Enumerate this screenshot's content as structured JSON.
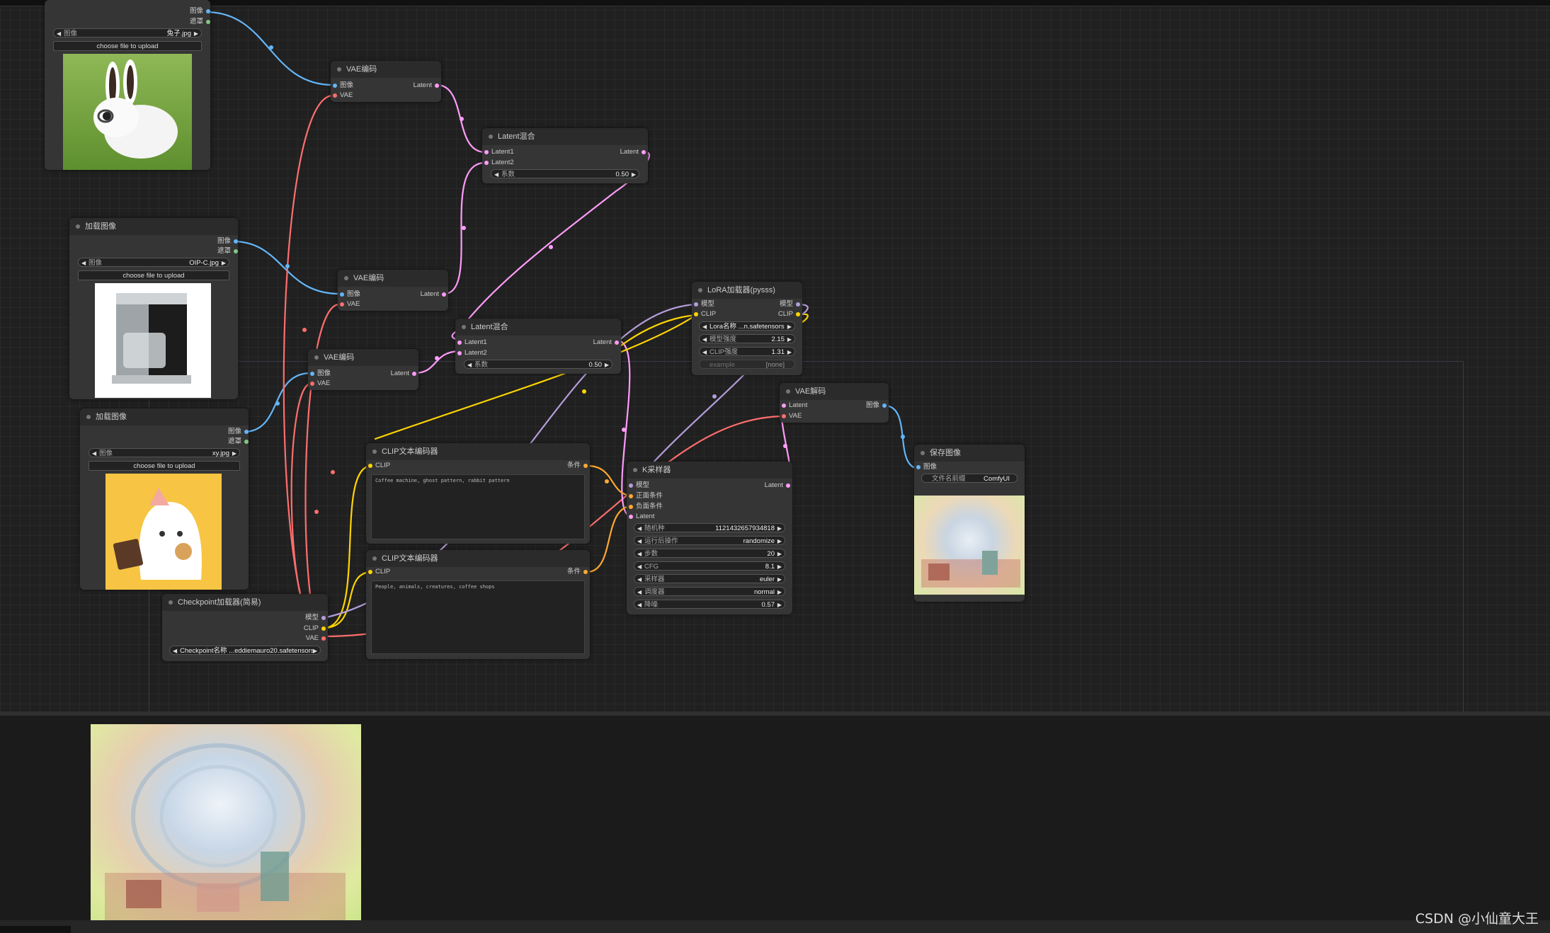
{
  "colors": {
    "image": "#64b5f6",
    "mask": "#81c784",
    "latent": "#ff9cf9",
    "vae": "#ff6e6e",
    "clip": "#ffd500",
    "model": "#b39ddb",
    "conditioning": "#ffa931"
  },
  "nodes": {
    "load_image_1": {
      "outputs": [
        "图像",
        "遮罩"
      ],
      "image_label": "图像",
      "image_value": "兔子.jpg",
      "upload": "choose file to upload",
      "icon": "rabbit-photo"
    },
    "load_image_2": {
      "title": "加载图像",
      "outputs": [
        "图像",
        "遮罩"
      ],
      "image_label": "图像",
      "image_value": "OIP-C.jpg",
      "upload": "choose file to upload",
      "icon": "coffee-machine-photo"
    },
    "load_image_3": {
      "title": "加载图像",
      "outputs": [
        "图像",
        "遮罩"
      ],
      "image_label": "图像",
      "image_value": "xy.jpg",
      "upload": "choose file to upload",
      "icon": "ghost-illustration"
    },
    "vae_encode_1": {
      "title": "VAE编码",
      "inputs": [
        "图像",
        "VAE"
      ],
      "output": "Latent"
    },
    "vae_encode_2": {
      "title": "VAE编码",
      "inputs": [
        "图像",
        "VAE"
      ],
      "output": "Latent"
    },
    "vae_encode_3": {
      "title": "VAE编码",
      "inputs": [
        "图像",
        "VAE"
      ],
      "output": "Latent"
    },
    "latent_blend_1": {
      "title": "Latent混合",
      "inputs": [
        "Latent1",
        "Latent2"
      ],
      "output": "Latent",
      "factor_label": "系数",
      "factor": "0.50"
    },
    "latent_blend_2": {
      "title": "Latent混合",
      "inputs": [
        "Latent1",
        "Latent2"
      ],
      "output": "Latent",
      "factor_label": "系数",
      "factor": "0.50"
    },
    "lora": {
      "title": "LoRA加载器(pysss)",
      "inputs": [
        "模型",
        "CLIP"
      ],
      "outputs": [
        "模型",
        "CLIP"
      ],
      "lora_value": "Lora名称 ...n.safetensors",
      "strength_model_label": "模型强度",
      "strength_model": "2.15",
      "strength_clip_label": "CLIP强度",
      "strength_clip": "1.31",
      "example_label": "example",
      "example_value": "[none]"
    },
    "vae_decode": {
      "title": "VAE解码",
      "inputs": [
        "Latent",
        "VAE"
      ],
      "output": "图像"
    },
    "save_image": {
      "title": "保存图像",
      "input": "图像",
      "prefix_label": "文件名前缀",
      "prefix": "ComfyUI"
    },
    "clip_encode_1": {
      "title": "CLIP文本编码器",
      "input": "CLIP",
      "output": "条件",
      "text": "Coffee machine, ghost pattern, rabbit pattern"
    },
    "clip_encode_2": {
      "title": "CLIP文本编码器",
      "input": "CLIP",
      "output": "条件",
      "text": "People, animals, creatures, coffee shops"
    },
    "ksampler": {
      "title": "K采样器",
      "inputs": [
        "模型",
        "正面条件",
        "负面条件",
        "Latent"
      ],
      "output": "Latent",
      "widgets": [
        {
          "label": "随机种",
          "value": "1121432657934818"
        },
        {
          "label": "运行后操作",
          "value": "randomize"
        },
        {
          "label": "步数",
          "value": "20"
        },
        {
          "label": "CFG",
          "value": "8.1"
        },
        {
          "label": "采样器",
          "value": "euler"
        },
        {
          "label": "调度器",
          "value": "normal"
        },
        {
          "label": "降噪",
          "value": "0.57"
        }
      ]
    },
    "checkpoint": {
      "title": "Checkpoint加载器(简易)",
      "outputs": [
        "模型",
        "CLIP",
        "VAE"
      ],
      "ckpt_value": "Checkpoint名称 ...eddiemauro20.safetensors"
    }
  },
  "watermark": "CSDN @小仙童大王"
}
